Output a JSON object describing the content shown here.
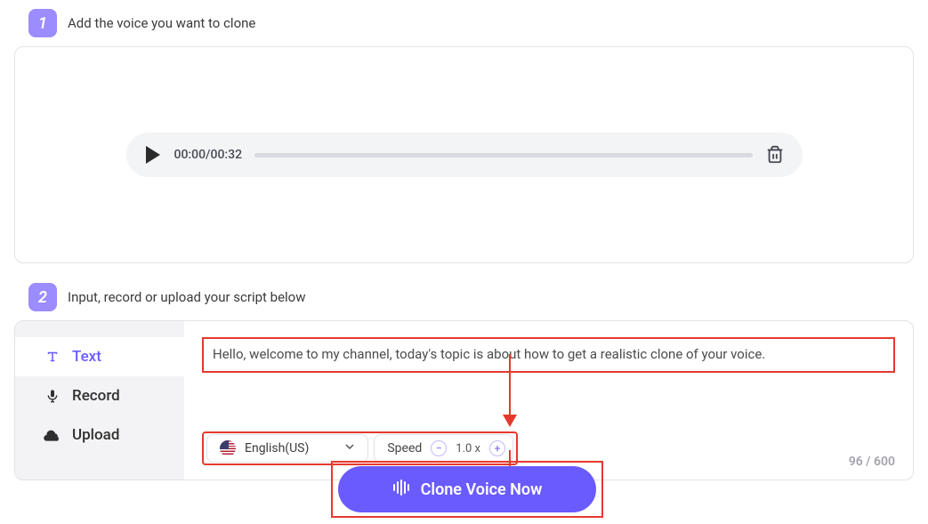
{
  "step1": {
    "number": "1",
    "title": "Add the voice you want to clone"
  },
  "player": {
    "current": "00:00",
    "sep": "/",
    "total": "00:32"
  },
  "step2": {
    "number": "2",
    "title": "Input, record or upload your script below"
  },
  "tabs": {
    "text": "Text",
    "record": "Record",
    "upload": "Upload"
  },
  "script": "Hello, welcome to my channel, today's topic is about how to get a realistic clone of your voice.",
  "language": {
    "label": "English(US)"
  },
  "speed": {
    "label": "Speed",
    "value": "1.0 x"
  },
  "counter": {
    "current": "96",
    "sep": " / ",
    "max": "600"
  },
  "clone_label": "Clone Voice Now"
}
